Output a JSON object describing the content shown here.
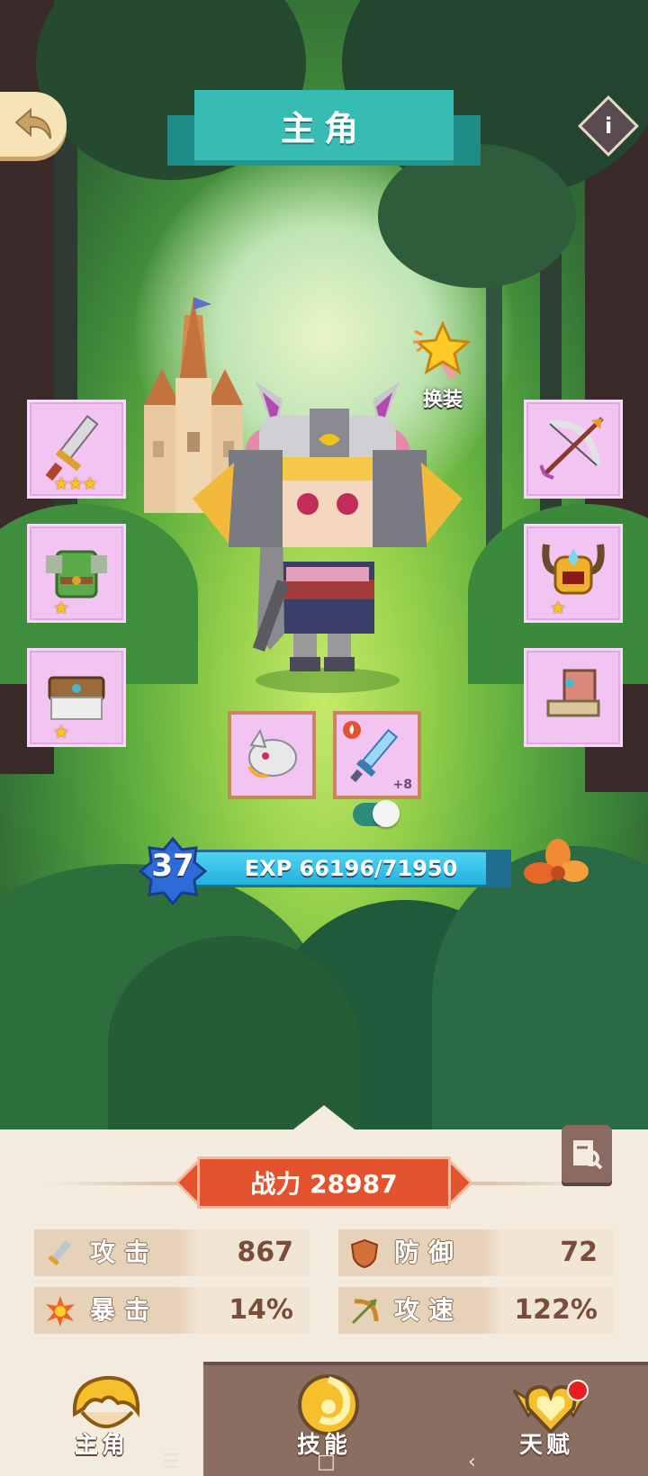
{
  "header": {
    "title": "主角"
  },
  "change_outfit": {
    "label": "换装"
  },
  "equipment": {
    "left": [
      {
        "slot": "weapon",
        "icon": "sword-icon",
        "stars": "★★★"
      },
      {
        "slot": "armor",
        "icon": "green-armor-icon",
        "stars": "★"
      },
      {
        "slot": "belt",
        "icon": "belt-icon",
        "stars": "★"
      }
    ],
    "right": [
      {
        "slot": "bow",
        "icon": "bow-icon",
        "stars": ""
      },
      {
        "slot": "helmet",
        "icon": "horned-helmet-icon",
        "stars": "★"
      },
      {
        "slot": "boots",
        "icon": "boots-icon",
        "stars": ""
      }
    ],
    "pet": {
      "icon": "pet-icon"
    },
    "spirit_weapon": {
      "icon": "blue-sword-icon",
      "plus": "+8"
    }
  },
  "level": {
    "value": "37",
    "exp_text": "EXP 66196/71950",
    "exp_current": 66196,
    "exp_max": 71950
  },
  "power": {
    "label": "战力 28987"
  },
  "stats": [
    {
      "label": "攻击",
      "value": "867",
      "icon": "attack-icon"
    },
    {
      "label": "防御",
      "value": "72",
      "icon": "defense-icon"
    },
    {
      "label": "暴击",
      "value": "14%",
      "icon": "crit-icon"
    },
    {
      "label": "攻速",
      "value": "122%",
      "icon": "attack-speed-icon"
    }
  ],
  "tabs": [
    {
      "label": "主角",
      "active": true
    },
    {
      "label": "技能",
      "active": false
    },
    {
      "label": "天赋",
      "active": false,
      "notification": true
    }
  ],
  "system_nav": {
    "menu": "☰",
    "home": "□",
    "back": "‹"
  },
  "colors": {
    "accent_teal": "#37bcb3",
    "power_red": "#e2532e",
    "slot_pink": "#f2c4f2"
  }
}
